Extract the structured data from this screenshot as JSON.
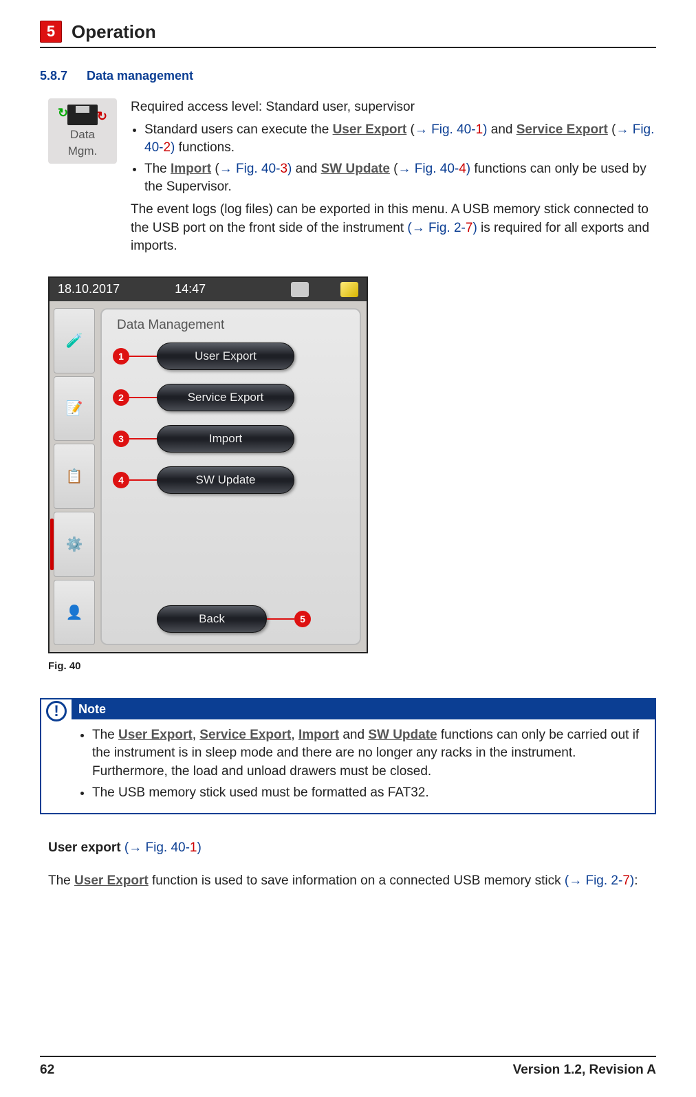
{
  "chapter": {
    "number": "5",
    "title": "Operation"
  },
  "section": {
    "number": "5.8.7",
    "title": "Data management"
  },
  "icon_tile": {
    "line1": "Data",
    "line2": "Mgm."
  },
  "intro": {
    "access_level": "Required access level: Standard user, supervisor",
    "bullet1_pre": "Standard users can execute the ",
    "user_export_link": "User Export",
    "bullet1_ref1_pre": " (",
    "bullet1_ref1": "→ Fig.  40",
    "bullet1_ref1_dash": "-",
    "bullet1_ref1_num": "1",
    "bullet1_ref1_post": ")",
    "bullet1_mid": " and ",
    "service_export_link": "Service Export",
    "bullet1_ref2_pre": " (",
    "bullet1_ref2": "→ Fig.  40",
    "bullet1_ref2_dash": "-",
    "bullet1_ref2_num": "2",
    "bullet1_ref2_post": ")",
    "bullet1_post": " functions.",
    "bullet2_pre": "The ",
    "import_link": "Import",
    "bullet2_ref1_pre": " (",
    "bullet2_ref1": "→ Fig.  40",
    "bullet2_ref1_dash": "-",
    "bullet2_ref1_num": "3",
    "bullet2_ref1_post": ")",
    "bullet2_mid": " and ",
    "sw_update_link": "SW Update",
    "bullet2_ref2_pre": " (",
    "bullet2_ref2": "→ Fig.  40",
    "bullet2_ref2_dash": "-",
    "bullet2_ref2_num": "4",
    "bullet2_ref2_post": ")",
    "bullet2_post": " functions can only be used by the Supervisor.",
    "para_pre": "The event logs (log files) can be exported in this menu. A USB memory stick connected to the USB port on the front side of the instrument ",
    "para_ref_pre": "(",
    "para_ref": "→ Fig.  2",
    "para_ref_dash": "-",
    "para_ref_num": "7",
    "para_ref_post": ")",
    "para_post": " is required for all exports and imports."
  },
  "screenshot": {
    "date": "18.10.2017",
    "time": "14:47",
    "panel_title": "Data Management",
    "buttons": {
      "user_export": "User Export",
      "service_export": "Service Export",
      "import": "Import",
      "sw_update": "SW Update",
      "back": "Back"
    },
    "callouts": {
      "c1": "1",
      "c2": "2",
      "c3": "3",
      "c4": "4",
      "c5": "5"
    }
  },
  "fig_caption": "Fig.  40",
  "note": {
    "header": "Note",
    "b1_pre": "The ",
    "b1_l1": "User Export",
    "b1_sep1": ", ",
    "b1_l2": "Service Export",
    "b1_sep2": ", ",
    "b1_l3": "Import",
    "b1_sep3": " and ",
    "b1_l4": "SW Update",
    "b1_post": " functions can only be carried out if the instrument is in sleep mode and there are no longer any racks in the instrument. Furthermore, the load and unload drawers must be closed.",
    "b2": "The USB memory stick used must be formatted as FAT32."
  },
  "subheading": {
    "bold": "User export",
    "ref_pre": " (",
    "ref": "→ Fig.  40",
    "ref_dash": "-",
    "ref_num": "1",
    "ref_post": ")"
  },
  "subtext": {
    "pre": "The ",
    "link": "User Export",
    "mid": " function is used to save information on a connected USB memory stick ",
    "ref_pre": "(",
    "ref": "→ Fig.  2",
    "ref_dash": "-",
    "ref_num": "7",
    "ref_post": ")",
    "post": ":"
  },
  "footer": {
    "page": "62",
    "version": "Version 1.2, Revision A"
  }
}
